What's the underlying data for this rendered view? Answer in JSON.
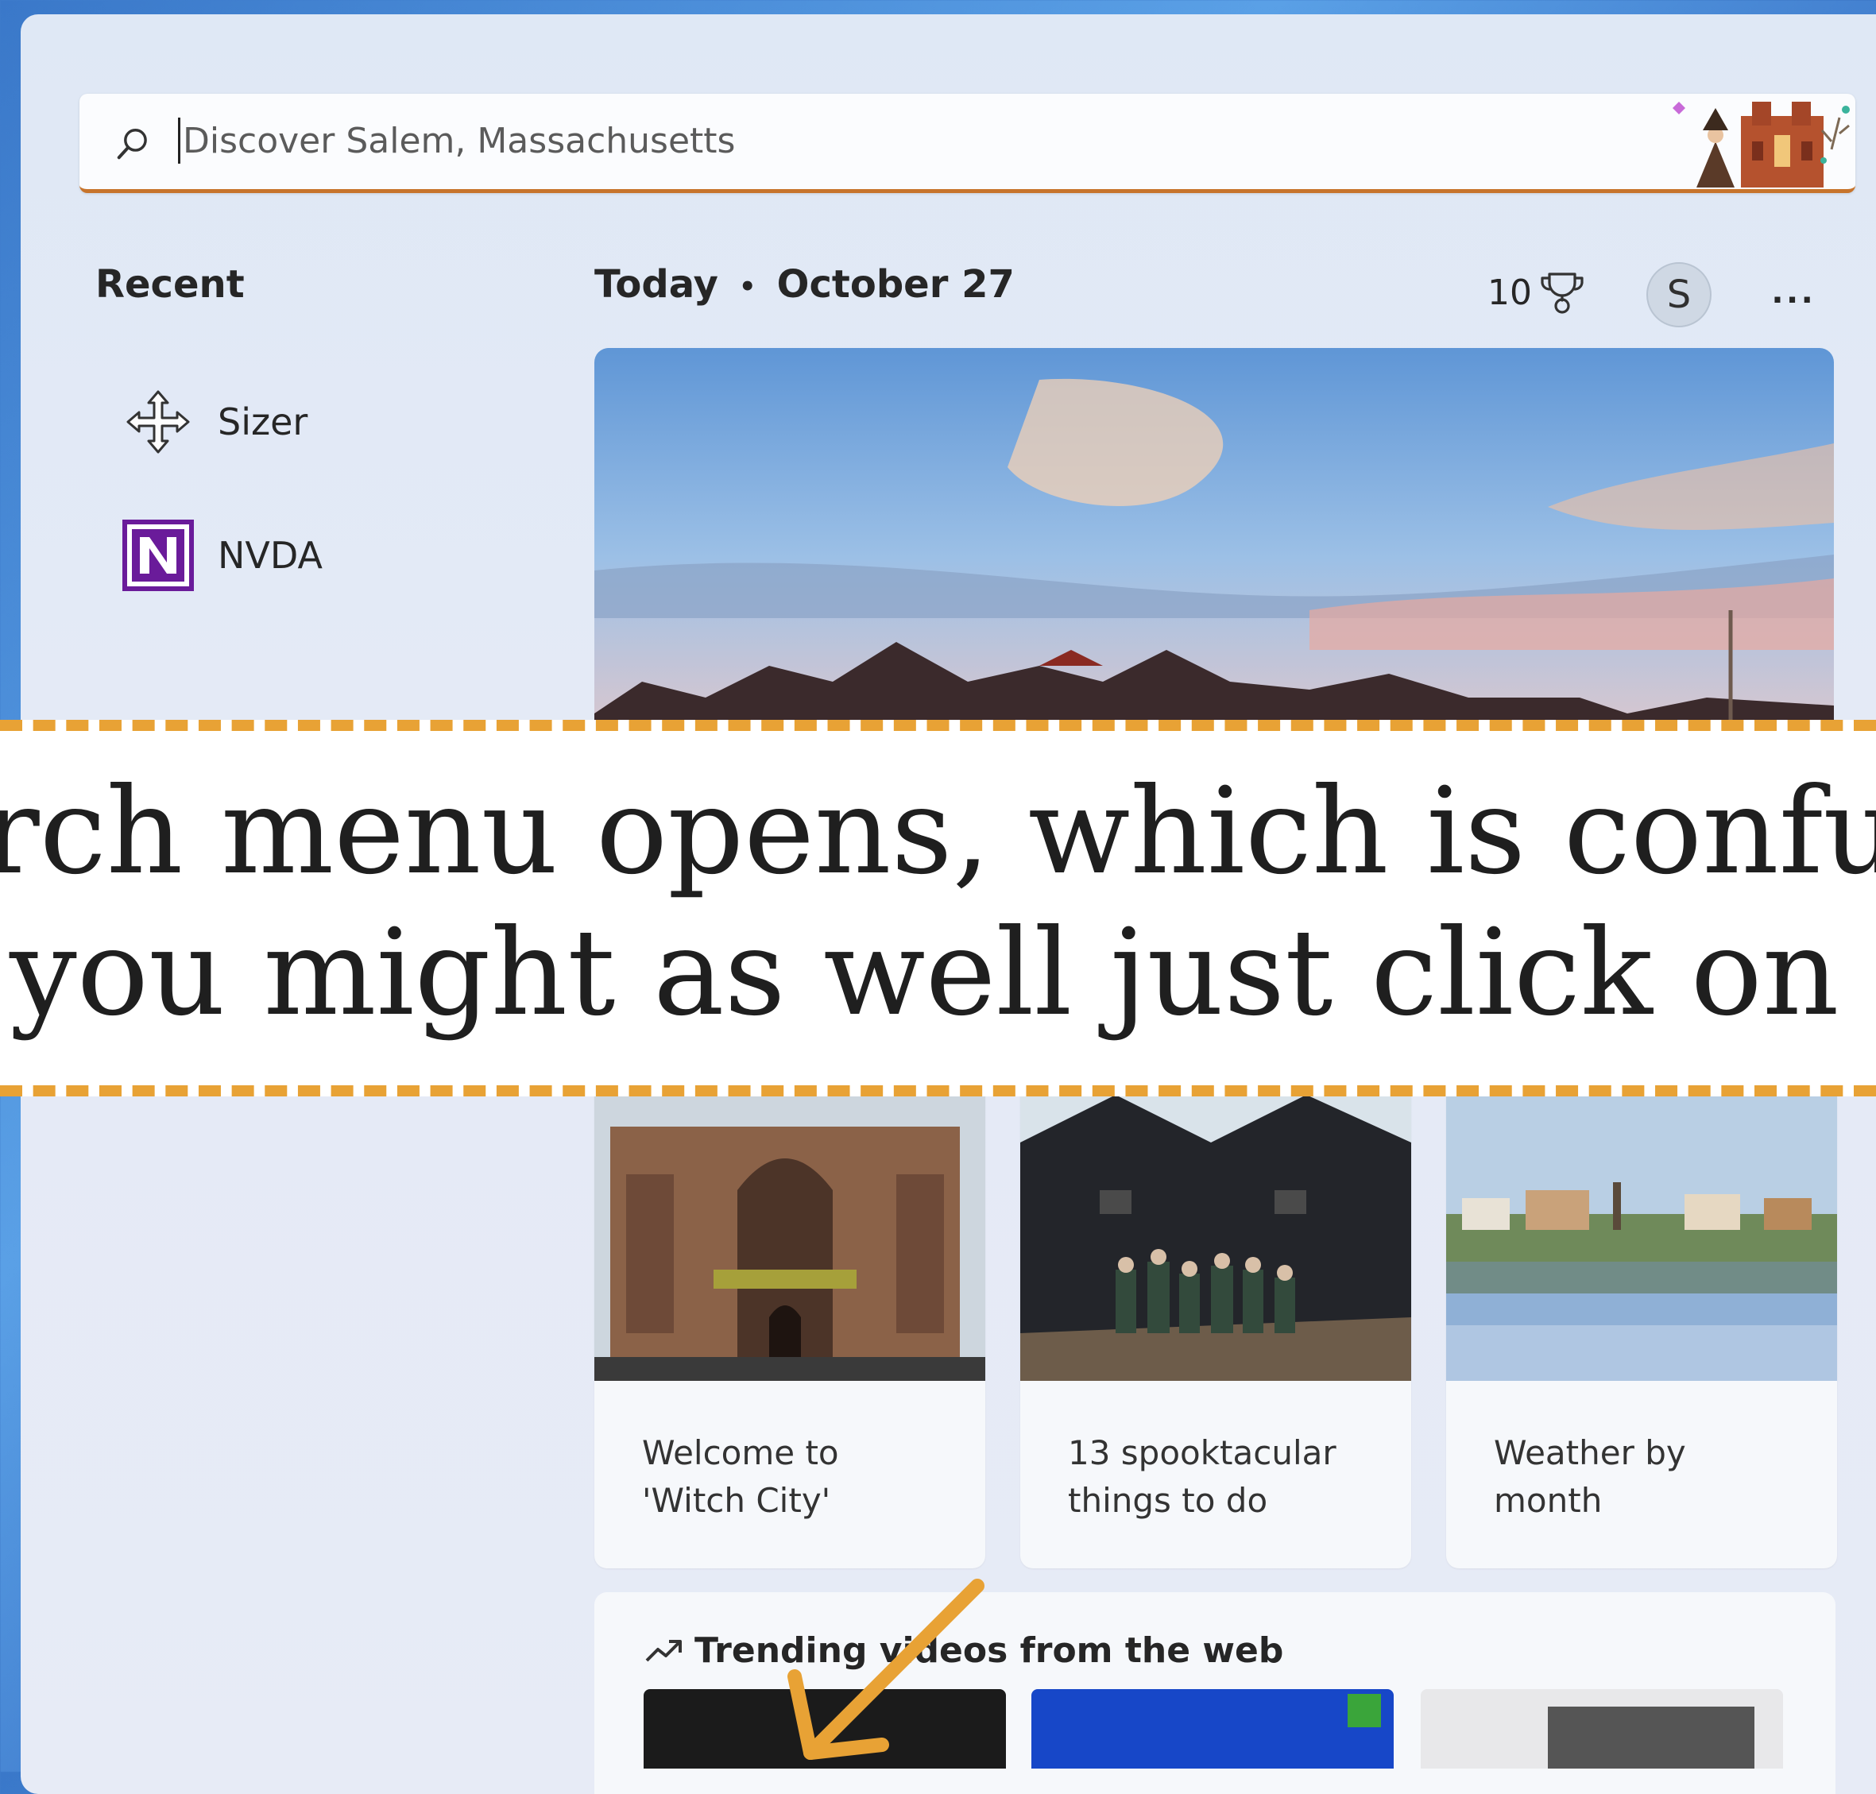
{
  "search": {
    "placeholder": "Discover Salem, Massachusetts"
  },
  "sidebar": {
    "title": "Recent",
    "items": [
      {
        "label": "Sizer",
        "icon": "move-arrows-icon"
      },
      {
        "label": "NVDA",
        "icon": "nvda-logo-icon"
      }
    ]
  },
  "header": {
    "today": "Today",
    "separator": "•",
    "date": "October 27",
    "points": "10",
    "avatar_initial": "S",
    "more": "···"
  },
  "cards": [
    {
      "title": "Welcome to 'Witch City'"
    },
    {
      "title": "13 spooktacular things to do"
    },
    {
      "title": "Weather by month"
    }
  ],
  "trending": {
    "title": "Trending videos from the web"
  },
  "overlay": {
    "line1": "rch menu opens, which is confu",
    "line2": "you might as well just click on"
  },
  "colors": {
    "accent": "#c7742c",
    "highlight": "#e8a235",
    "nvda_purple": "#6a1b9a"
  }
}
